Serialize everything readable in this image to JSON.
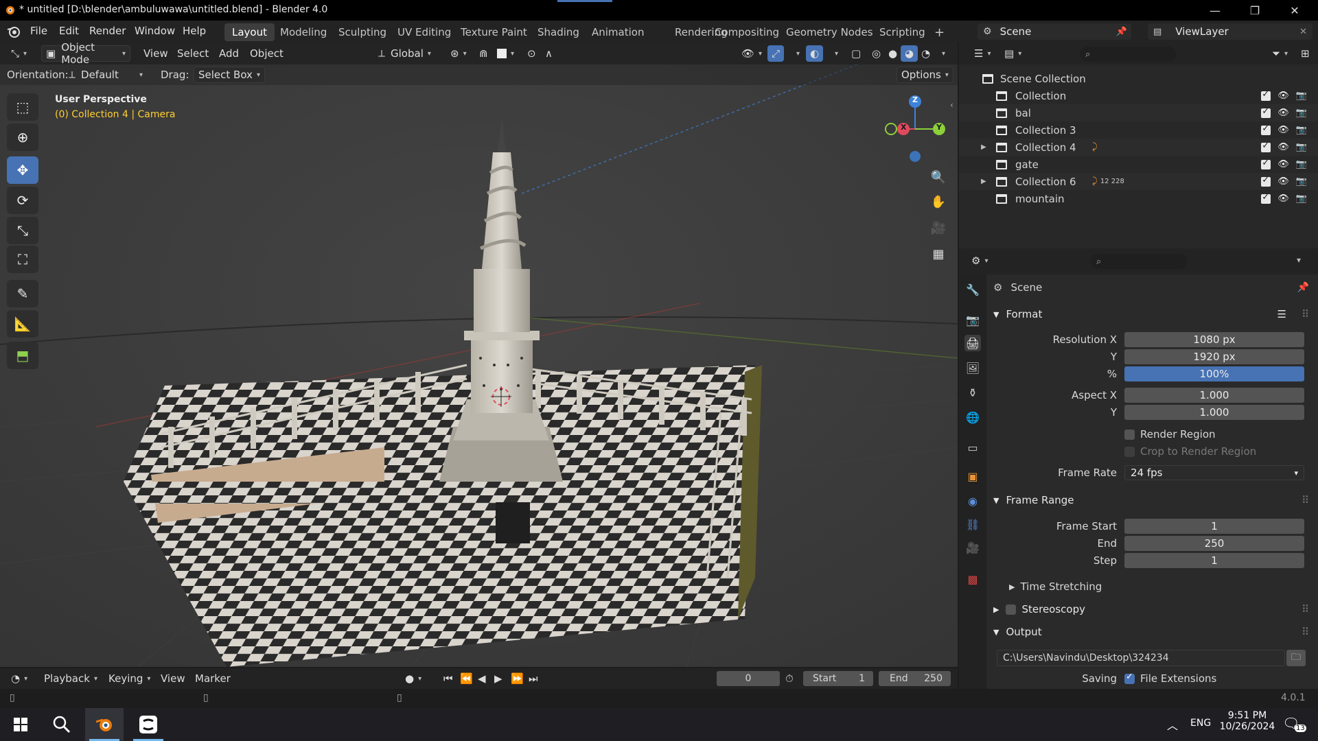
{
  "window": {
    "title": "* untitled [D:\\blender\\ambuluwawa\\untitled.blend] - Blender 4.0",
    "minimize": "—",
    "maximize": "❐",
    "close": "✕"
  },
  "menu": {
    "file": "File",
    "edit": "Edit",
    "render": "Render",
    "window": "Window",
    "help": "Help"
  },
  "workspaces": [
    "Layout",
    "Modeling",
    "Sculpting",
    "UV Editing",
    "Texture Paint",
    "Shading",
    "Animation",
    "Rendering",
    "Compositing",
    "Geometry Nodes",
    "Scripting"
  ],
  "workspace_add": "+",
  "scene_selector": {
    "value": "Scene"
  },
  "viewlayer_selector": {
    "value": "ViewLayer"
  },
  "viewport": {
    "mode": "Object Mode",
    "menus": {
      "view": "View",
      "select": "Select",
      "add": "Add",
      "object": "Object"
    },
    "transform_orientation": "Global",
    "orientation_label": "Orientation:",
    "orientation_value": "Default",
    "drag_label": "Drag:",
    "drag_value": "Select Box",
    "options": "Options",
    "perspective": "User Perspective",
    "context": "(0) Collection 4 | Camera",
    "gizmo": {
      "x": "X",
      "y": "Y",
      "z": "Z"
    }
  },
  "outliner": {
    "root": "Scene Collection",
    "items": [
      {
        "name": "Collection",
        "expandable": false
      },
      {
        "name": "bal",
        "expandable": false
      },
      {
        "name": "Collection 3",
        "expandable": false
      },
      {
        "name": "Collection 4",
        "expandable": true
      },
      {
        "name": "gate",
        "expandable": false
      },
      {
        "name": "Collection 6",
        "expandable": true,
        "badge": "12 228"
      },
      {
        "name": "mountain",
        "expandable": false
      }
    ]
  },
  "properties": {
    "scene": "Scene",
    "format": {
      "header": "Format",
      "resolution_x_label": "Resolution X",
      "resolution_x": "1080 px",
      "y_label": "Y",
      "resolution_y": "1920 px",
      "percent_label": "%",
      "percent": "100%",
      "aspect_x_label": "Aspect X",
      "aspect_x": "1.000",
      "aspect_y_label": "Y",
      "aspect_y": "1.000",
      "render_region": "Render Region",
      "crop_region": "Crop to Render Region",
      "frame_rate_label": "Frame Rate",
      "frame_rate": "24 fps"
    },
    "frame_range": {
      "header": "Frame Range",
      "start_label": "Frame Start",
      "start": "1",
      "end_label": "End",
      "end": "250",
      "step_label": "Step",
      "step": "1",
      "time_stretching": "Time Stretching"
    },
    "stereoscopy": "Stereoscopy",
    "output": {
      "header": "Output",
      "path": "C:\\Users\\Navindu\\Desktop\\324234",
      "saving_label": "Saving",
      "file_extensions": "File Extensions"
    }
  },
  "timeline": {
    "playback": "Playback",
    "keying": "Keying",
    "view": "View",
    "marker": "Marker",
    "current_frame": "0",
    "start_label": "Start",
    "start": "1",
    "end_label": "End",
    "end": "250"
  },
  "statusbar": {
    "version": "4.0.1"
  },
  "taskbar": {
    "language": "ENG",
    "time": "9:51 PM",
    "date": "10/26/2024",
    "notifications": "13"
  },
  "colors": {
    "accent": "#4772b3",
    "axis_x": "#e04a5f",
    "axis_y": "#8ccf3a",
    "axis_z": "#3d82d8",
    "context_text": "#ffcf33"
  }
}
